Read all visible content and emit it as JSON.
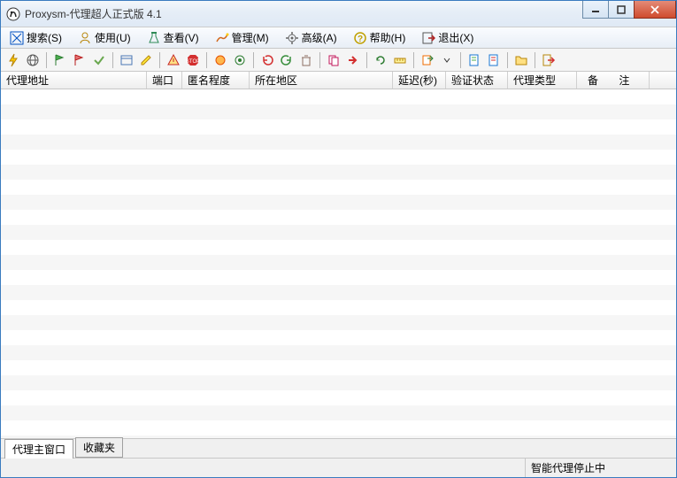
{
  "window": {
    "title": "Proxysm-代理超人正式版 4.1"
  },
  "menu": {
    "search": "搜索(S)",
    "use": "使用(U)",
    "view": "查看(V)",
    "manage": "管理(M)",
    "advanced": "高级(A)",
    "help": "帮助(H)",
    "exit": "退出(X)"
  },
  "columns": {
    "address": "代理地址",
    "port": "端口",
    "anon": "匿名程度",
    "region": "所在地区",
    "delay": "延迟(秒)",
    "status": "验证状态",
    "type": "代理类型",
    "remark": "备   注"
  },
  "tabs": {
    "main": "代理主窗口",
    "fav": "收藏夹"
  },
  "status": {
    "left": "",
    "right": "智能代理停止中"
  }
}
